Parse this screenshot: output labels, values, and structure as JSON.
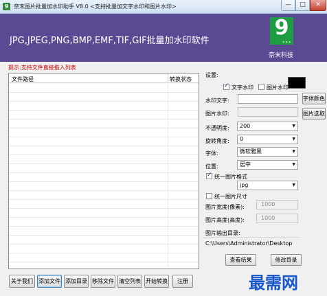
{
  "window": {
    "title": "奈末图片批量加水印助手 V8.0   <支持批量加文字水印和图片水印>",
    "app_icon": "9",
    "controls": {
      "minimize": "—",
      "maximize": "□",
      "close": "✕"
    }
  },
  "banner": {
    "title": "JPG,JPEG,PNG,BMP,EMF,TIF,GIF批量加水印软件",
    "logo_glyph": "9",
    "logo_dots": "...",
    "company": "奈末科技",
    "background": "#5b4a93",
    "logo_color": "#1f9d43"
  },
  "left": {
    "hint": "提示:支持文件直接拖入列表",
    "columns": [
      "文件路径",
      "转换状态"
    ],
    "rows": []
  },
  "buttons": {
    "about": "关于我们",
    "add_file": "添加文件",
    "add_dir": "添加目录",
    "remove_file": "移除文件",
    "clear_list": "清空列表",
    "start": "开始转换",
    "register": "注册"
  },
  "settings": {
    "label": "设置:",
    "text_wm_check": "文字水印",
    "image_wm_check": "图片水印",
    "text_wm_checked": true,
    "image_wm_checked": false,
    "swatch_color": "#000000",
    "text_wm_label": "水印文字:",
    "text_wm_value": "",
    "font_color_btn": "字体颜色",
    "image_wm_label": "图片水印:",
    "image_wm_value": "",
    "image_pick_btn": "图片选取",
    "opacity_label": "不透明度:",
    "opacity_value": "200",
    "rotate_label": "旋转角度:",
    "rotate_value": "0",
    "font_label": "字体:",
    "font_value": "微软雅黑",
    "position_label": "位置:",
    "position_value": "居中",
    "unify_format_check": "统一图片格式",
    "unify_format_checked": true,
    "format_value": "jpg",
    "unify_size_check": "统一图片尺寸",
    "unify_size_checked": false,
    "width_label": "图片宽度(像素):",
    "width_value": "1000",
    "height_label": "图片高度(高度):",
    "height_value": "1000",
    "output_label": "图片输出目录:",
    "output_path": "C:\\Users\\Administrator\\Desktop",
    "view_result_btn": "查看结果",
    "modify_dir_btn": "修改目录"
  },
  "watermark_overlay": "最需网"
}
